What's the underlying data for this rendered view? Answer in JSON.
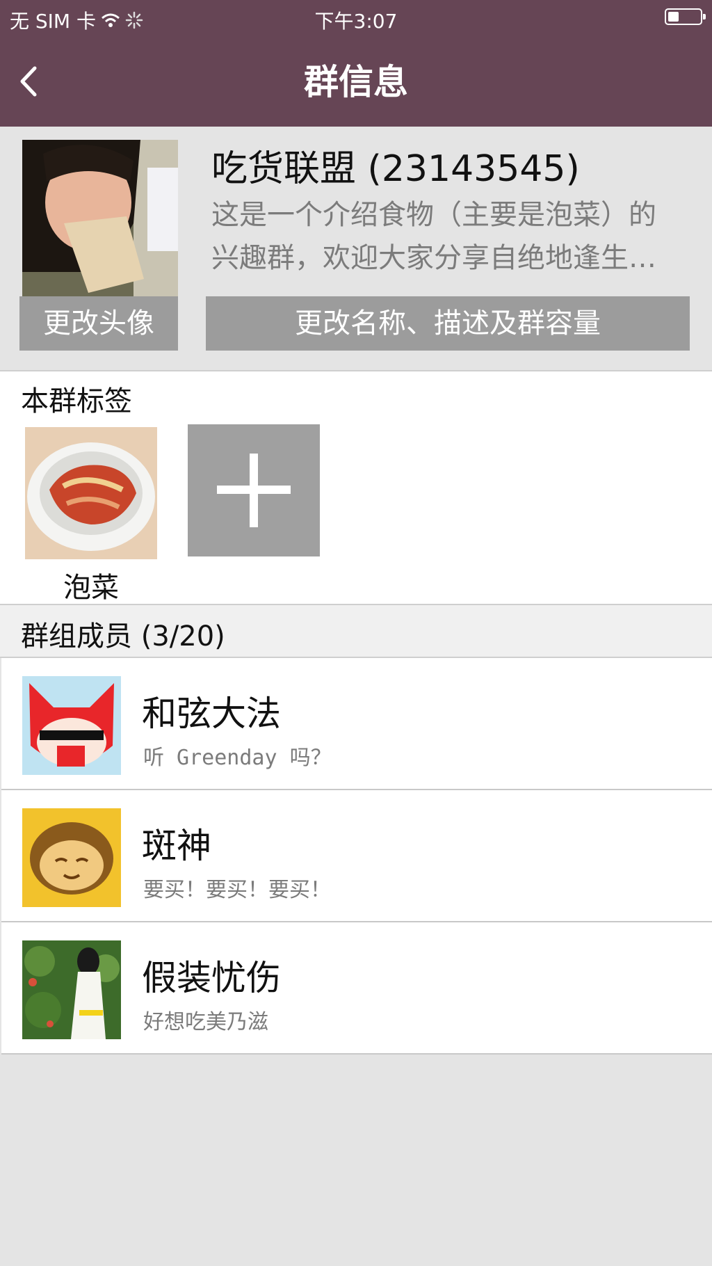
{
  "status_bar": {
    "carrier": "无 SIM 卡",
    "time": "下午3:07",
    "battery_level": 0.35
  },
  "nav": {
    "title": "群信息",
    "back_icon": "chevron-left-icon"
  },
  "group": {
    "name": "吃货联盟 (23143545)",
    "description_line1": "这是一个介绍食物（主要是泡菜）的",
    "description_line2": "兴趣群，欢迎大家分享自绝地逢生…",
    "change_avatar_label": "更改头像",
    "edit_info_label": "更改名称、描述及群容量"
  },
  "tags": {
    "section_title": "本群标签",
    "items": [
      {
        "label": "泡菜"
      }
    ],
    "add_icon": "plus-icon"
  },
  "members": {
    "section_title": "群组成员 (3/20)",
    "items": [
      {
        "name": "和弦大法",
        "status": "听 Greenday 吗？"
      },
      {
        "name": "斑神",
        "status": "要买！要买！要买！"
      },
      {
        "name": "假装忧伤",
        "status": "好想吃美乃滋"
      }
    ]
  },
  "colors": {
    "header": "#664555",
    "button_gray": "#9c9c9c",
    "background": "#e4e4e4"
  }
}
